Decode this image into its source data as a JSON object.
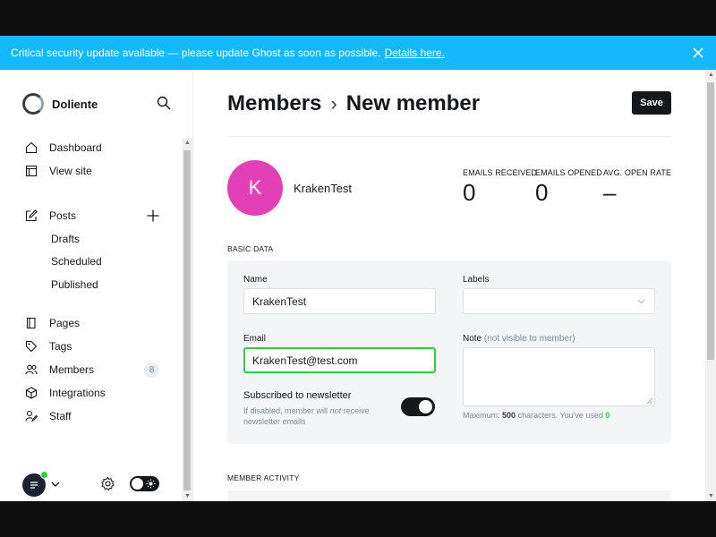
{
  "alert": {
    "message": "Critical security update available — please update Ghost as soon as possible.",
    "link": "Details here."
  },
  "sidebar": {
    "site_name": "Doliente",
    "items": [
      {
        "label": "Dashboard",
        "icon": "home-icon"
      },
      {
        "label": "View site",
        "icon": "window-icon"
      },
      {
        "label": "Posts",
        "icon": "edit-icon"
      },
      {
        "label": "Pages",
        "icon": "page-icon"
      },
      {
        "label": "Tags",
        "icon": "tag-icon"
      },
      {
        "label": "Members",
        "icon": "members-icon",
        "badge": "8"
      },
      {
        "label": "Integrations",
        "icon": "cube-icon"
      },
      {
        "label": "Staff",
        "icon": "staff-icon"
      }
    ],
    "post_subitems": [
      "Drafts",
      "Scheduled",
      "Published"
    ]
  },
  "header": {
    "breadcrumb_parent": "Members",
    "breadcrumb_current": "New member",
    "save_label": "Save"
  },
  "member": {
    "initial": "K",
    "name": "KrakenTest",
    "avatar_color": "#e33fb6"
  },
  "stats": [
    {
      "label": "EMAILS RECEIVED",
      "value": "0"
    },
    {
      "label": "EMAILS OPENED",
      "value": "0"
    },
    {
      "label": "AVG. OPEN RATE",
      "value": "–"
    }
  ],
  "basic_data": {
    "section_title": "BASIC DATA",
    "name_label": "Name",
    "name_value": "KrakenTest",
    "labels_label": "Labels",
    "labels_value": "",
    "email_label": "Email",
    "email_value": "KrakenTest@test.com",
    "note_label": "Note",
    "note_hint": "(not visible to member)",
    "note_value": "",
    "newsletter_title": "Subscribed to newsletter",
    "newsletter_help_1": "If disabled, member will",
    "newsletter_help_em": "not",
    "newsletter_help_2": "receive newsletter emails",
    "newsletter_enabled": true,
    "counter_prefix": "Maximum:",
    "counter_max": "500",
    "counter_mid": "characters. You've used",
    "counter_used": "0"
  },
  "activity": {
    "section_title": "MEMBER ACTIVITY"
  },
  "colors": {
    "alert_bg": "#14b8ff",
    "accent_green": "#30cf43",
    "dark": "#15171a"
  }
}
